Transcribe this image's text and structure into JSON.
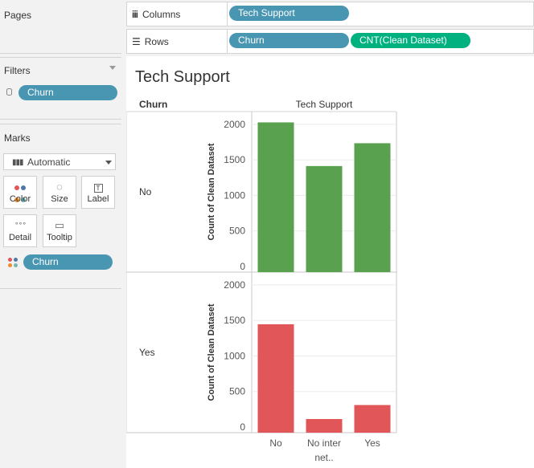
{
  "pages": {
    "title": "Pages"
  },
  "filters": {
    "title": "Filters",
    "pill": "Churn"
  },
  "marks": {
    "title": "Marks",
    "type_select": "Automatic",
    "buttons": {
      "color": "Color",
      "size": "Size",
      "label": "Label",
      "detail": "Detail",
      "tooltip": "Tooltip"
    },
    "color_pill": "Churn"
  },
  "shelves": {
    "columns_label": "Columns",
    "columns_pills": [
      "Tech Support"
    ],
    "rows_label": "Rows",
    "rows_pills": [
      "Churn",
      "CNT(Clean Dataset)"
    ]
  },
  "sheet": {
    "title": "Tech Support",
    "row_header": "Churn",
    "col_header": "Tech Support"
  },
  "chart_data": {
    "type": "bar",
    "title": "Tech Support",
    "categories": [
      "No",
      "No internet service",
      "Yes"
    ],
    "category_display": [
      "No",
      "No inter­net..",
      "Yes"
    ],
    "ylabel": "Count of Clean Dataset",
    "ylim": [
      0,
      2100
    ],
    "yticks": [
      0,
      500,
      1000,
      1500,
      2000
    ],
    "grid": true,
    "panes": [
      {
        "row_label": "No",
        "color": "#59a14f",
        "values": [
          2027,
          1413,
          1734
        ]
      },
      {
        "row_label": "Yes",
        "color": "#e15759",
        "values": [
          1446,
          113,
          310
        ]
      }
    ]
  }
}
